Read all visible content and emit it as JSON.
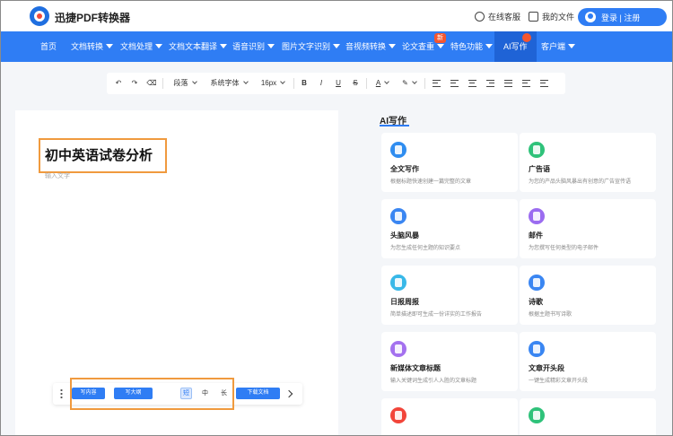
{
  "header": {
    "brand": "迅捷PDF转换器",
    "service_label": "在线客服",
    "docs_label": "我的文件",
    "login_label": "登录 | 注册"
  },
  "nav": {
    "items": [
      {
        "label": "首页",
        "caret": false
      },
      {
        "label": "文档转换",
        "caret": true
      },
      {
        "label": "文档处理",
        "caret": true
      },
      {
        "label": "文档文本翻译",
        "caret": true
      },
      {
        "label": "语音识别",
        "caret": true
      },
      {
        "label": "图片文字识别",
        "caret": true
      },
      {
        "label": "音视频转换",
        "caret": true
      },
      {
        "label": "论文查重",
        "caret": true,
        "badge": "新"
      },
      {
        "label": "特色功能",
        "caret": true
      },
      {
        "label": "AI写作",
        "caret": false,
        "active": true
      },
      {
        "label": "客户端",
        "caret": true
      }
    ]
  },
  "toolbar": {
    "paragraph": "段落",
    "font": "系统字体",
    "size": "16px",
    "bold": "B",
    "italic": "I",
    "underline": "U",
    "strike": "S",
    "font_color": "A"
  },
  "document": {
    "title": "初中英语试卷分析",
    "placeholder": "输入文字"
  },
  "bottom_bar": {
    "write_content": "写内容",
    "write_outline": "写大纲",
    "short": "短",
    "medium": "中",
    "long": "长",
    "download": "下载文档"
  },
  "ai_panel": {
    "title": "AI写作",
    "cards": [
      {
        "title": "全文写作",
        "desc": "根据标题快速创建一篇完整的文章",
        "color": "#2f8df0"
      },
      {
        "title": "广告语",
        "desc": "为您的产品头脑风暴出有创意的广告宣传语",
        "color": "#2fc27a"
      },
      {
        "title": "头脑风暴",
        "desc": "为您生成任何主题的知识要点",
        "color": "#3a86f2"
      },
      {
        "title": "邮件",
        "desc": "为您撰写任何类型的电子邮件",
        "color": "#9b6cf0"
      },
      {
        "title": "日报周报",
        "desc": "简单描述即可生成一份详实的工作报告",
        "color": "#38b8e8"
      },
      {
        "title": "诗歌",
        "desc": "根据主题书写诗歌",
        "color": "#3a86f2"
      },
      {
        "title": "新媒体文章标题",
        "desc": "输入关键词生成引人入胜的文章标题",
        "color": "#a471ef"
      },
      {
        "title": "文章开头段",
        "desc": "一键生成精彩文章开头段",
        "color": "#3a86f2"
      },
      {
        "title": "",
        "desc": "",
        "color": "#f2453a"
      },
      {
        "title": "",
        "desc": "",
        "color": "#2fc27a"
      }
    ]
  }
}
